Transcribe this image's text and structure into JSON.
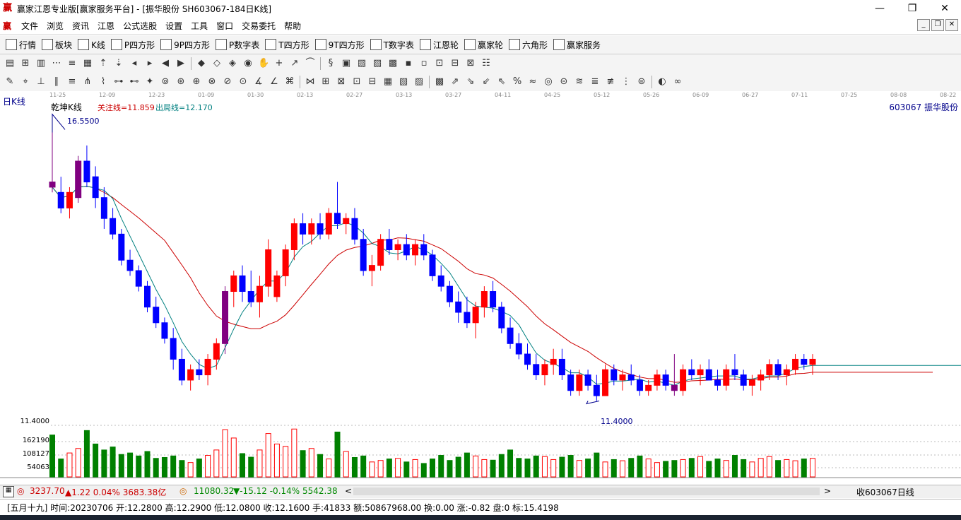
{
  "window": {
    "title": "赢家江恩专业版[赢家服务平台] - [振华股份  SH603067-184日K线]",
    "min_label": "—",
    "max_label": "❐",
    "close_label": "✕"
  },
  "menu": [
    "文件",
    "浏览",
    "资讯",
    "江恩",
    "公式选股",
    "设置",
    "工具",
    "窗口",
    "交易委托",
    "帮助"
  ],
  "toolbar1": [
    {
      "icon": "grid-icon",
      "label": "行情"
    },
    {
      "icon": "blocks-icon",
      "label": "板块"
    },
    {
      "icon": "candle-icon",
      "label": "K线"
    },
    {
      "icon": "ps-icon",
      "label": "P四方形"
    },
    {
      "icon": "p9-icon",
      "label": "9P四方形"
    },
    {
      "icon": "pn-icon",
      "label": "P数字表"
    },
    {
      "icon": "ts-icon",
      "label": "T四方形"
    },
    {
      "icon": "t9-icon",
      "label": "9T四方形"
    },
    {
      "icon": "tn-icon",
      "label": "T数字表"
    },
    {
      "icon": "wheel-icon",
      "label": "江恩轮"
    },
    {
      "icon": "wheel2-icon",
      "label": "赢家轮"
    },
    {
      "icon": "hexagon-icon",
      "label": "六角形"
    },
    {
      "icon": "dollar-icon",
      "label": "赢家服务"
    }
  ],
  "chart": {
    "period_label": "日K线",
    "indicator_name": "乾坤K线",
    "focus_line": "关注线=11.859",
    "exit_line": "出局线=12.170",
    "symbol": "603067  振华股份",
    "high_label": "16.5500",
    "low_label": "11.4000",
    "date_ticks": [
      "11-25",
      "12-09",
      "12-23",
      "01-09",
      "01-30",
      "02-13",
      "02-27",
      "03-13",
      "03-27",
      "04-11",
      "04-25",
      "05-12",
      "05-26",
      "06-09",
      "06-27",
      "07-11",
      "07-25",
      "08-08",
      "08-22"
    ],
    "price_axis": {
      "low": 11.4,
      "high": 16.55
    },
    "volume_axis_labels": [
      "11.4000",
      "162190",
      "108127",
      "54063"
    ]
  },
  "chart_data": {
    "type": "candlestick",
    "ohlc": [
      [
        15.6,
        16.55,
        15.4,
        15.5
      ],
      [
        15.4,
        15.7,
        15.0,
        15.1
      ],
      [
        15.1,
        15.5,
        14.9,
        15.4
      ],
      [
        15.3,
        16.1,
        15.2,
        16.0
      ],
      [
        16.0,
        16.3,
        15.5,
        15.6
      ],
      [
        15.7,
        15.9,
        15.1,
        15.3
      ],
      [
        15.3,
        15.5,
        14.7,
        14.9
      ],
      [
        14.9,
        15.1,
        14.5,
        14.6
      ],
      [
        14.6,
        14.7,
        14.0,
        14.1
      ],
      [
        14.1,
        14.3,
        13.8,
        13.9
      ],
      [
        13.9,
        14.0,
        13.5,
        13.6
      ],
      [
        13.6,
        13.7,
        13.1,
        13.2
      ],
      [
        13.2,
        13.4,
        12.8,
        12.9
      ],
      [
        12.9,
        13.0,
        12.5,
        12.6
      ],
      [
        12.6,
        12.8,
        12.0,
        12.2
      ],
      [
        12.2,
        12.4,
        11.7,
        11.8
      ],
      [
        11.8,
        12.1,
        11.6,
        12.0
      ],
      [
        12.0,
        12.2,
        11.8,
        11.9
      ],
      [
        11.9,
        12.3,
        11.7,
        12.2
      ],
      [
        12.2,
        12.6,
        12.0,
        12.5
      ],
      [
        12.5,
        13.6,
        12.3,
        13.5
      ],
      [
        13.5,
        13.9,
        13.2,
        13.8
      ],
      [
        13.8,
        14.0,
        13.3,
        13.5
      ],
      [
        13.5,
        13.9,
        13.2,
        13.3
      ],
      [
        13.3,
        13.8,
        13.0,
        13.6
      ],
      [
        13.6,
        14.5,
        13.4,
        14.3
      ],
      [
        13.4,
        13.9,
        13.3,
        13.8
      ],
      [
        13.8,
        14.4,
        13.6,
        14.3
      ],
      [
        14.3,
        14.9,
        14.1,
        14.8
      ],
      [
        14.8,
        15.0,
        14.4,
        14.6
      ],
      [
        14.6,
        14.9,
        14.4,
        14.8
      ],
      [
        14.8,
        15.0,
        14.5,
        14.6
      ],
      [
        14.6,
        15.1,
        14.5,
        15.0
      ],
      [
        15.0,
        15.6,
        14.7,
        14.8
      ],
      [
        14.8,
        15.0,
        14.6,
        14.9
      ],
      [
        14.9,
        15.1,
        14.4,
        14.5
      ],
      [
        14.5,
        14.7,
        13.8,
        13.9
      ],
      [
        13.9,
        14.2,
        13.6,
        14.0
      ],
      [
        14.0,
        14.6,
        13.9,
        14.5
      ],
      [
        14.5,
        14.7,
        14.2,
        14.3
      ],
      [
        14.3,
        14.5,
        14.1,
        14.4
      ],
      [
        14.4,
        14.6,
        14.1,
        14.2
      ],
      [
        14.2,
        14.5,
        14.0,
        14.4
      ],
      [
        14.4,
        14.6,
        14.1,
        14.2
      ],
      [
        14.2,
        14.3,
        13.7,
        13.8
      ],
      [
        13.8,
        14.0,
        13.5,
        13.6
      ],
      [
        13.6,
        13.7,
        13.2,
        13.3
      ],
      [
        13.3,
        13.5,
        12.9,
        13.1
      ],
      [
        13.1,
        13.4,
        12.8,
        12.9
      ],
      [
        12.9,
        13.3,
        12.6,
        13.2
      ],
      [
        13.2,
        13.6,
        13.0,
        13.5
      ],
      [
        13.5,
        13.7,
        13.1,
        13.2
      ],
      [
        13.2,
        13.3,
        12.7,
        12.8
      ],
      [
        12.8,
        13.0,
        12.4,
        12.5
      ],
      [
        12.5,
        12.7,
        12.2,
        12.3
      ],
      [
        12.3,
        12.5,
        12.0,
        12.1
      ],
      [
        12.1,
        12.3,
        11.8,
        11.9
      ],
      [
        11.9,
        12.2,
        11.7,
        12.1
      ],
      [
        12.1,
        12.4,
        11.9,
        12.2
      ],
      [
        12.2,
        12.4,
        11.8,
        11.9
      ],
      [
        11.9,
        12.0,
        11.5,
        11.6
      ],
      [
        11.6,
        12.0,
        11.5,
        11.9
      ],
      [
        11.9,
        12.0,
        11.6,
        11.7
      ],
      [
        11.7,
        11.9,
        11.4,
        11.5
      ],
      [
        11.5,
        12.1,
        11.5,
        12.0
      ],
      [
        12.0,
        12.1,
        11.7,
        11.8
      ],
      [
        11.8,
        12.0,
        11.6,
        11.9
      ],
      [
        11.9,
        12.1,
        11.7,
        11.8
      ],
      [
        11.8,
        11.9,
        11.5,
        11.6
      ],
      [
        11.6,
        11.8,
        11.5,
        11.7
      ],
      [
        11.7,
        12.0,
        11.6,
        11.9
      ],
      [
        11.9,
        12.0,
        11.6,
        11.7
      ],
      [
        11.7,
        12.3,
        11.5,
        11.6
      ],
      [
        11.6,
        12.1,
        11.5,
        12.0
      ],
      [
        12.0,
        12.2,
        11.8,
        11.9
      ],
      [
        11.9,
        12.1,
        11.7,
        12.0
      ],
      [
        12.0,
        12.2,
        11.8,
        11.8
      ],
      [
        11.8,
        12.0,
        11.6,
        11.7
      ],
      [
        11.7,
        12.1,
        11.6,
        12.0
      ],
      [
        12.0,
        12.3,
        11.8,
        11.9
      ],
      [
        11.9,
        12.0,
        11.6,
        11.7
      ],
      [
        11.7,
        11.9,
        11.5,
        11.8
      ],
      [
        11.8,
        12.0,
        11.6,
        11.9
      ],
      [
        11.9,
        12.2,
        11.8,
        12.1
      ],
      [
        12.1,
        12.2,
        11.8,
        11.9
      ],
      [
        11.9,
        12.1,
        11.7,
        12.0
      ],
      [
        12.0,
        12.3,
        11.9,
        12.2
      ],
      [
        12.2,
        12.3,
        12.0,
        12.1
      ],
      [
        12.1,
        12.3,
        11.9,
        12.2
      ]
    ],
    "volume": [
      140000,
      60000,
      80000,
      95000,
      155000,
      110000,
      90000,
      100000,
      75000,
      80000,
      70000,
      85000,
      62000,
      65000,
      70000,
      55000,
      48000,
      60000,
      72000,
      90000,
      158000,
      130000,
      78000,
      66000,
      90000,
      145000,
      110000,
      102000,
      160000,
      88000,
      95000,
      75000,
      60000,
      150000,
      85000,
      65000,
      70000,
      50000,
      55000,
      60000,
      62000,
      50000,
      58000,
      45000,
      60000,
      72000,
      55000,
      66000,
      80000,
      70000,
      58000,
      56000,
      75000,
      90000,
      62000,
      60000,
      70000,
      68000,
      58000,
      66000,
      72000,
      55000,
      60000,
      80000,
      50000,
      58000,
      54000,
      62000,
      70000,
      60000,
      48000,
      52000,
      55000,
      58000,
      62000,
      68000,
      52000,
      60000,
      55000,
      72000,
      58000,
      50000,
      62000,
      68000,
      55000,
      58000,
      54000,
      60000,
      62000
    ]
  },
  "status": {
    "sh_index": "3237.70",
    "sh_change": "▲1.22 0.04% 3683.38亿",
    "sz_index": "11080.32",
    "sz_change": "▼-15.12 -0.14% 5542.38",
    "right_label": "收603067日线",
    "info": "[五月十九] 时间:20230706 开:12.2800 高:12.2900 低:12.0800 收:12.1600 手:41833 额:50867968.00 换:0.00 涨:-0.82 盘:0 标:15.4198"
  }
}
